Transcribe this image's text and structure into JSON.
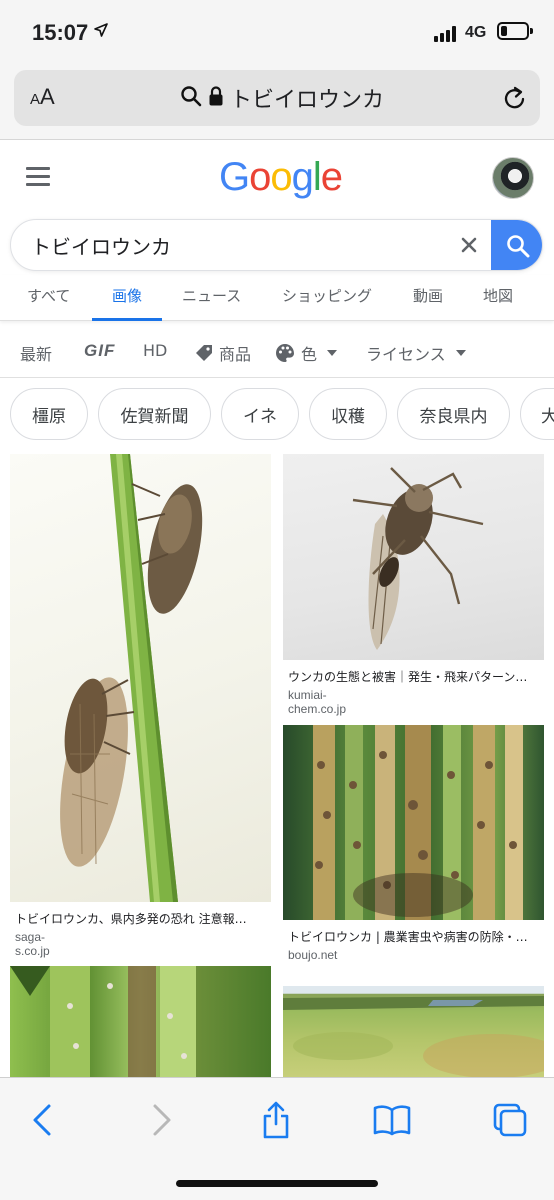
{
  "status_bar": {
    "time": "15:07",
    "network": "4G",
    "battery_level": 0.25
  },
  "address_bar": {
    "text_size_label": "AA",
    "url_text": "トビイロウンカ"
  },
  "header": {
    "logo": "Google"
  },
  "search": {
    "query": "トビイロウンカ"
  },
  "tabs": [
    {
      "label": "すべて",
      "active": false
    },
    {
      "label": "画像",
      "active": true
    },
    {
      "label": "ニュース",
      "active": false
    },
    {
      "label": "ショッピング",
      "active": false
    },
    {
      "label": "動画",
      "active": false
    },
    {
      "label": "地図",
      "active": false
    }
  ],
  "filters": {
    "latest": "最新",
    "gif": "GIF",
    "hd": "HD",
    "products": "商品",
    "color": "色",
    "license": "ライセンス"
  },
  "chips": [
    "橿原",
    "佐賀新聞",
    "イネ",
    "収穫",
    "奈良県内",
    "大"
  ],
  "results": [
    {
      "caption": "トビイロウンカ、県内多発の恐れ 注意報…",
      "source": "saga-s.co.jp"
    },
    {
      "caption": "ウンカの生態と被害｜発生・飛来パターン…",
      "source": "kumiai-chem.co.jp"
    },
    {
      "caption": "トビイロウンカ | 農業害虫や病害の防除・…",
      "source": "boujo.net"
    }
  ],
  "colors": {
    "google_blue": "#4285f4",
    "google_red": "#ea4335",
    "google_yellow": "#fbbc05",
    "google_green": "#34a853",
    "tab_active": "#1a73e8",
    "safari_blue": "#1a7cf0"
  },
  "icons": [
    "location-arrow-icon",
    "signal-icon",
    "battery-icon",
    "search-icon",
    "lock-icon",
    "reload-icon",
    "menu-icon",
    "clear-icon",
    "tag-icon",
    "palette-icon",
    "back-icon",
    "forward-icon",
    "share-icon",
    "bookmarks-icon",
    "tabs-icon"
  ]
}
